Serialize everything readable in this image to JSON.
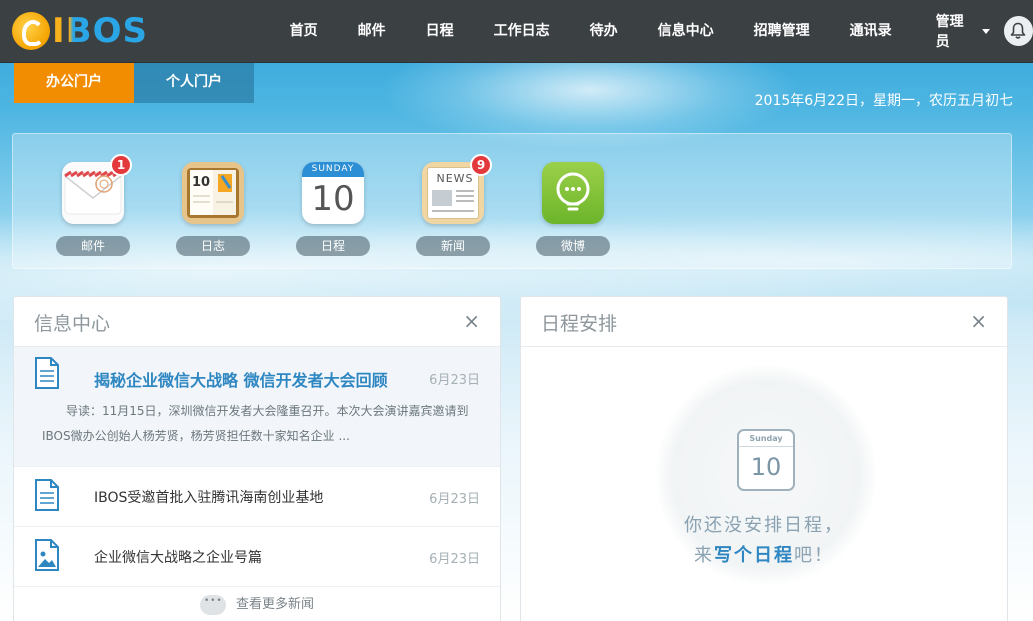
{
  "brand": {
    "logo_text": "IBOS"
  },
  "nav": {
    "items": [
      "首页",
      "邮件",
      "日程",
      "工作日志",
      "待办",
      "信息中心",
      "招聘管理",
      "通讯录"
    ],
    "admin_label": "管理员"
  },
  "portal_tabs": {
    "active": "办公门户",
    "other": "个人门户"
  },
  "date_text": "2015年6月22日，星期一，农历五月初七",
  "apps": [
    {
      "label": "邮件",
      "badge": "1",
      "icon": "mail-icon"
    },
    {
      "label": "日志",
      "badge": "",
      "icon": "diary-icon"
    },
    {
      "label": "日程",
      "badge": "",
      "icon": "calendar-icon",
      "icon_top": "SUNDAY",
      "icon_num": "10"
    },
    {
      "label": "新闻",
      "badge": "9",
      "icon": "news-icon",
      "icon_top": "NEWS"
    },
    {
      "label": "微博",
      "badge": "",
      "icon": "weibo-icon"
    }
  ],
  "info_panel": {
    "title": "信息中心",
    "close": "×",
    "featured": {
      "title": "揭秘企业微信大战略 微信开发者大会回顾",
      "date": "6月23日",
      "summary": "导读：11月15日，深圳微信开发者大会隆重召开。本次大会演讲嘉宾邀请到IBOS微办公创始人杨芳贤，杨芳贤担任数十家知名企业 ..."
    },
    "items": [
      {
        "title": "IBOS受邀首批入驻腾讯海南创业基地",
        "date": "6月23日",
        "icon": "document-icon"
      },
      {
        "title": "企业微信大战略之企业号篇",
        "date": "6月23日",
        "icon": "image-document-icon"
      }
    ],
    "more": "查看更多新闻"
  },
  "schedule_panel": {
    "title": "日程安排",
    "close": "×",
    "empty_cal_top": "Sunday",
    "empty_cal_num": "10",
    "empty_line1": "你还没安排日程，",
    "empty_line2_pre": "来",
    "empty_line2_bold": "写个日程",
    "empty_line2_post": "吧！"
  },
  "colors": {
    "topbar": "#3b4043",
    "active_tab": "#f28c00",
    "badge": "#e4393c",
    "featured_title": "#2f87c2"
  }
}
